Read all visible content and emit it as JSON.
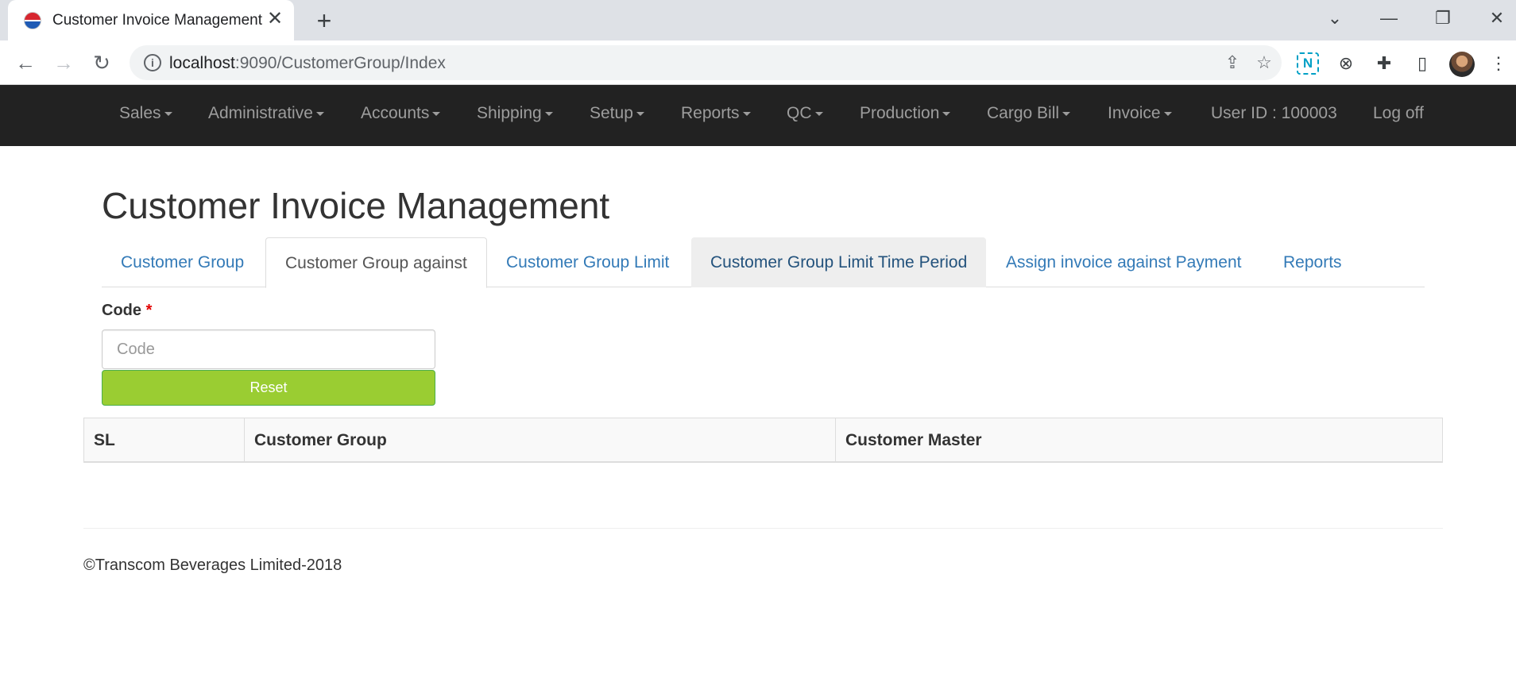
{
  "browser": {
    "tab_title": "Customer Invoice Management",
    "tab_close": "✕",
    "new_tab": "+",
    "url_host": "localhost",
    "url_path": ":9090/CustomerGroup/Index",
    "controls": {
      "dropdown": "⌄",
      "minimize": "—",
      "restore": "❐",
      "close": "✕"
    }
  },
  "navbar": {
    "items": [
      {
        "label": "Sales",
        "dropdown": true
      },
      {
        "label": "Administrative",
        "dropdown": true
      },
      {
        "label": "Accounts",
        "dropdown": true
      },
      {
        "label": "Shipping",
        "dropdown": true
      },
      {
        "label": "Setup",
        "dropdown": true
      },
      {
        "label": "Reports",
        "dropdown": true
      },
      {
        "label": "QC",
        "dropdown": true
      },
      {
        "label": "Production",
        "dropdown": true
      },
      {
        "label": "Cargo Bill",
        "dropdown": true
      },
      {
        "label": "Invoice",
        "dropdown": true
      }
    ],
    "user_id": "User ID : 100003",
    "logoff": "Log off"
  },
  "page": {
    "title": "Customer Invoice Management",
    "tabs": [
      {
        "label": "Customer Group",
        "state": "normal"
      },
      {
        "label": "Customer Group against",
        "state": "active"
      },
      {
        "label": "Customer Group Limit",
        "state": "normal"
      },
      {
        "label": "Customer Group Limit Time Period",
        "state": "hover"
      },
      {
        "label": "Assign invoice against Payment",
        "state": "normal"
      },
      {
        "label": "Reports",
        "state": "normal"
      }
    ],
    "form": {
      "code_label": "Code",
      "required_mark": "*",
      "code_placeholder": "Code",
      "code_value": "",
      "reset_label": "Reset"
    },
    "table": {
      "headers": [
        "SL",
        "Customer Group",
        "Customer Master"
      ],
      "rows": []
    },
    "footer": "©Transcom Beverages Limited-2018"
  },
  "colors": {
    "navbar_bg": "#222222",
    "link": "#337ab7",
    "reset_button": "#9acd32",
    "required": "#e30000"
  }
}
